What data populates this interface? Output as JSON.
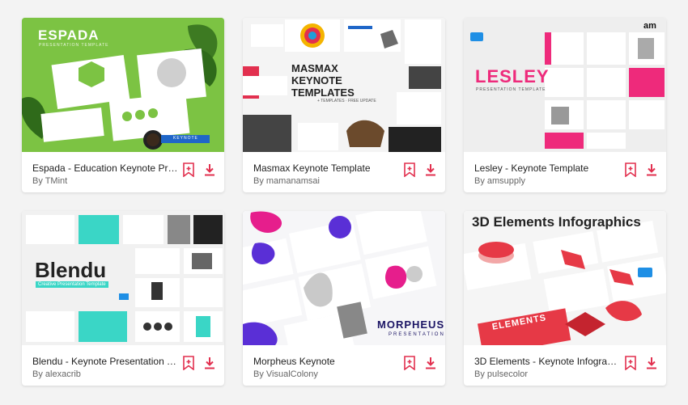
{
  "colors": {
    "accent": "#e2304f",
    "page_bg": "#f3f3f3"
  },
  "items": [
    {
      "title": "Espada - Education Keynote Pres…",
      "author": "By TMint",
      "thumb": {
        "headline": "ESPADA",
        "subtitle": "PRESENTATION TEMPLATE",
        "badge": "KEYNOTE",
        "accent": "#7cc343"
      }
    },
    {
      "title": "Masmax Keynote Template",
      "author": "By mamanamsai",
      "thumb": {
        "headline": "MASMAX KEYNOTE TEMPLATES",
        "subtitle": "+ TEMPLATES · FREE UPDATE",
        "accent": "#e2304f"
      }
    },
    {
      "title": "Lesley - Keynote Template",
      "author": "By amsupply",
      "thumb": {
        "headline": "LESLEY",
        "subtitle": "PRESENTATION TEMPLATE",
        "logo": "am",
        "accent": "#ee2a7b"
      }
    },
    {
      "title": "Blendu - Keynote Presentation Te…",
      "author": "By alexacrib",
      "thumb": {
        "headline": "Blendu",
        "subtitle": "Creative Presentation Template",
        "accent": "#3ad6c6"
      }
    },
    {
      "title": "Morpheus Keynote",
      "author": "By VisualColony",
      "thumb": {
        "headline": "MORPHEUS",
        "subtitle": "PRESENTATION",
        "accent": "#5a2fd6"
      }
    },
    {
      "title": "3D Elements - Keynote Infographi…",
      "author": "By pulsecolor",
      "thumb": {
        "headline": "3D Elements Infographics",
        "subtitle": "ELEMENTS",
        "accent": "#e63946"
      }
    }
  ],
  "icons": {
    "bookmark": "bookmark-add-icon",
    "download": "download-icon"
  }
}
